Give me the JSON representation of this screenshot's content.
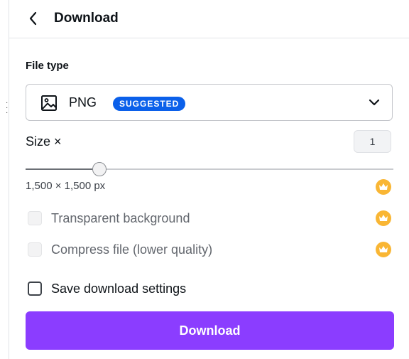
{
  "header": {
    "title": "Download",
    "back_icon": "chevron-left-icon"
  },
  "file_type": {
    "label": "File type",
    "selected": "PNG",
    "badge": "SUGGESTED",
    "badge_color": "#0b60ea",
    "icon": "image-icon",
    "dropdown_icon": "chevron-down-icon"
  },
  "size": {
    "label": "Size ×",
    "multiplier": "1",
    "slider_value": 0.2,
    "dimensions": "1,500 × 1,500 px"
  },
  "options": [
    {
      "label": "Transparent background",
      "checked": false,
      "enabled": false,
      "premium": true
    },
    {
      "label": "Compress file (lower quality)",
      "checked": false,
      "enabled": false,
      "premium": true
    }
  ],
  "save_settings": {
    "label": "Save download settings",
    "checked": false
  },
  "download_button": {
    "label": "Download"
  },
  "colors": {
    "accent": "#8b3dff",
    "premium": "#f9b634"
  }
}
